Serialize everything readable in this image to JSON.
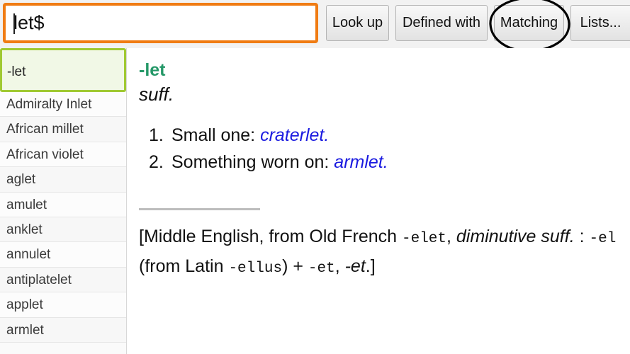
{
  "search": {
    "value": "let$",
    "placeholder": "Enter word or pattern"
  },
  "toolbar": {
    "lookup_label": "Look up",
    "defined_with_label": "Defined with",
    "matching_label": "Matching",
    "lists_label": "Lists...",
    "annotation": "ellipse-highlight-around-matching"
  },
  "colors": {
    "search_border": "#f07c13",
    "selected_border": "#a0c932",
    "selected_bg": "#f1f8e6",
    "headword": "#259868",
    "example_link": "#1a1ae0"
  },
  "sidebar": {
    "items": [
      {
        "label": "-let",
        "selected": true
      },
      {
        "label": "Admiralty Inlet",
        "selected": false
      },
      {
        "label": "African millet",
        "selected": false
      },
      {
        "label": "African violet",
        "selected": false
      },
      {
        "label": "aglet",
        "selected": false
      },
      {
        "label": "amulet",
        "selected": false
      },
      {
        "label": "anklet",
        "selected": false
      },
      {
        "label": "annulet",
        "selected": false
      },
      {
        "label": "antiplatelet",
        "selected": false
      },
      {
        "label": "applet",
        "selected": false
      },
      {
        "label": "armlet",
        "selected": false
      }
    ]
  },
  "entry": {
    "headword": "-let",
    "part_of_speech": "suff.",
    "senses": [
      {
        "num": "1.",
        "text": "Small one: ",
        "example": "craterlet."
      },
      {
        "num": "2.",
        "text": "Something worn on: ",
        "example": "armlet."
      }
    ],
    "etymology": {
      "open": "[Middle English, from Old French ",
      "mono1": "-elet",
      "comma1": ", ",
      "ital1": "diminutive suff.",
      "colon": " : ",
      "mono2": "-el",
      "paren_open": " (from Latin ",
      "mono3": "-ellus",
      "paren_close": ") + ",
      "mono4": "-et",
      "comma2": ", ",
      "ital2": "-et",
      "close": ".]"
    }
  }
}
